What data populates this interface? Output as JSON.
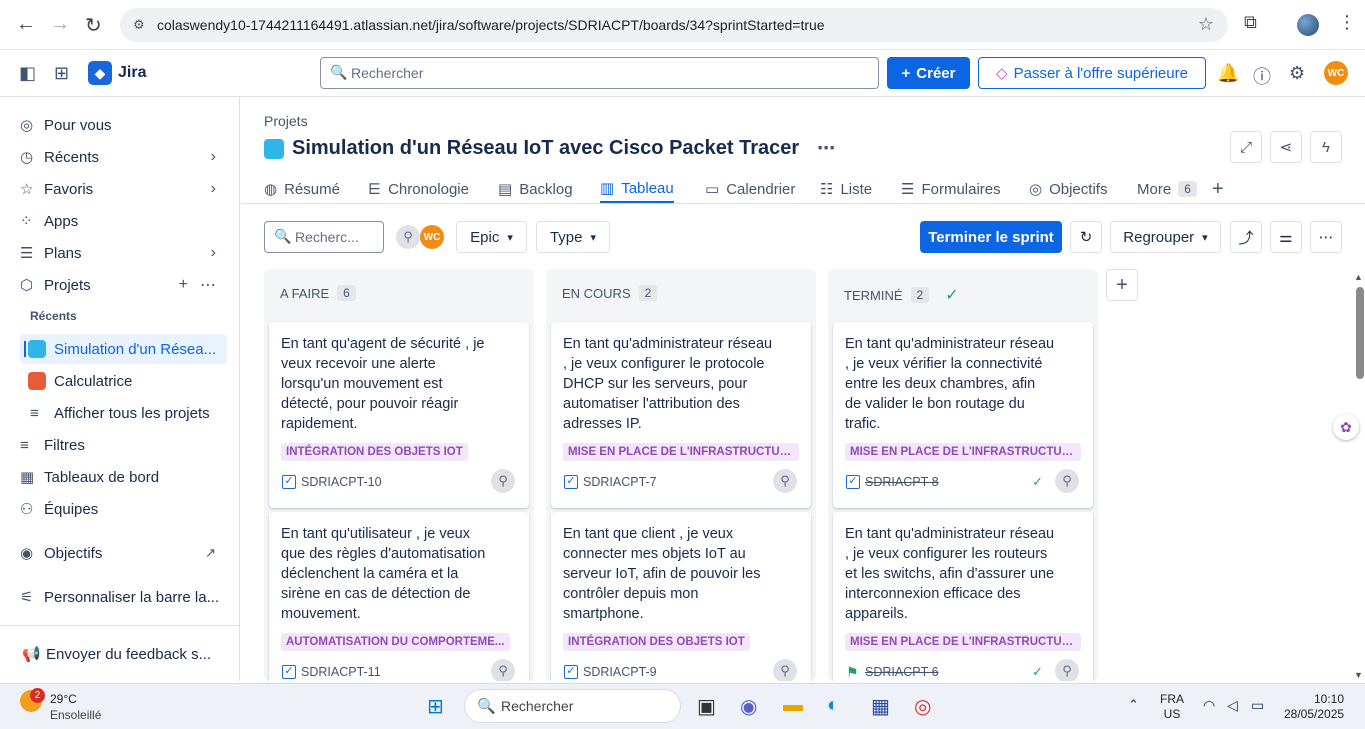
{
  "browser": {
    "url": "colaswendy10-1744211164491.atlassian.net/jira/software/projects/SDRIACPT/boards/34?sprintStarted=true"
  },
  "topbar": {
    "app_name": "Jira",
    "search_placeholder": "Rechercher",
    "create_label": "Créer",
    "upgrade_label": "Passer à l'offre supérieure",
    "user_initials": "WC"
  },
  "sidebar": {
    "items": [
      {
        "label": "Pour vous"
      },
      {
        "label": "Récents"
      },
      {
        "label": "Favoris"
      },
      {
        "label": "Apps"
      },
      {
        "label": "Plans"
      },
      {
        "label": "Projets"
      }
    ],
    "recent_label": "Récents",
    "projects": [
      {
        "label": "Simulation d'un Résea..."
      },
      {
        "label": "Calculatrice"
      },
      {
        "label": "Afficher tous les projets"
      }
    ],
    "more_items": [
      {
        "label": "Filtres"
      },
      {
        "label": "Tableaux de bord"
      },
      {
        "label": "Équipes"
      },
      {
        "label": "Objectifs"
      },
      {
        "label": "Personnaliser la barre la..."
      }
    ],
    "feedback_label": "Envoyer du feedback s..."
  },
  "main": {
    "breadcrumb": "Projets",
    "title": "Simulation d'un Réseau IoT avec Cisco Packet Tracer",
    "tabs": [
      {
        "label": "Résumé"
      },
      {
        "label": "Chronologie"
      },
      {
        "label": "Backlog"
      },
      {
        "label": "Tableau"
      },
      {
        "label": "Calendrier"
      },
      {
        "label": "Liste"
      },
      {
        "label": "Formulaires"
      },
      {
        "label": "Objectifs"
      },
      {
        "label": "More",
        "count": "6"
      }
    ],
    "board_search_placeholder": "Recherc...",
    "filter_epic": "Epic",
    "filter_type": "Type",
    "complete_sprint": "Terminer le sprint",
    "group_by": "Regrouper"
  },
  "colors": {
    "accent": "#0c66e4",
    "epic_bg": "#f3e6fa",
    "epic_text": "#8f4bb5"
  },
  "columns": [
    {
      "title": "A FAIRE",
      "count": "6",
      "cards": [
        {
          "text": "En tant qu'agent de sécurité , je veux recevoir une alerte lorsqu'un mouvement est détecté, pour pouvoir réagir rapidement.",
          "epic": "INTÉGRATION DES OBJETS IOT",
          "key": "SDRIACPT-10"
        },
        {
          "text": "En tant qu'utilisateur , je veux que des règles d'automatisation déclenchent la caméra et la sirène en cas de détection de mouvement.",
          "epic": "AUTOMATISATION DU COMPORTEME...",
          "key": "SDRIACPT-11"
        }
      ]
    },
    {
      "title": "EN COURS",
      "count": "2",
      "cards": [
        {
          "text": "En tant qu'administrateur réseau , je veux configurer le protocole DHCP sur les serveurs, pour automatiser l'attribution des adresses IP.",
          "epic": "MISE EN PLACE DE L'INFRASTRUCTUR...",
          "key": "SDRIACPT-7"
        },
        {
          "text": "En tant que client , je veux connecter mes objets IoT au serveur IoT, afin de pouvoir les contrôler depuis mon smartphone.",
          "epic": "INTÉGRATION DES OBJETS IOT",
          "key": "SDRIACPT-9"
        }
      ]
    },
    {
      "title": "TERMINÉ",
      "count": "2",
      "cards": [
        {
          "text": "En tant qu'administrateur réseau , je veux vérifier la connectivité entre les deux chambres, afin de valider le bon routage du trafic.",
          "epic": "MISE EN PLACE DE L'INFRASTRUCTUR...",
          "key": "SDRIACPT-8"
        },
        {
          "text": "En tant qu'administrateur réseau , je veux configurer les routeurs et les switchs, afin d'assurer une interconnexion efficace des appareils.",
          "epic": "MISE EN PLACE DE L'INFRASTRUCTUR...",
          "key": "SDRIACPT-6"
        }
      ]
    }
  ],
  "taskbar": {
    "temperature": "29°C",
    "weather": "Ensoleillé",
    "weather_badge": "2",
    "search_placeholder": "Rechercher",
    "lang_1": "FRA",
    "lang_2": "US",
    "time": "10:10",
    "date": "28/05/2025"
  }
}
